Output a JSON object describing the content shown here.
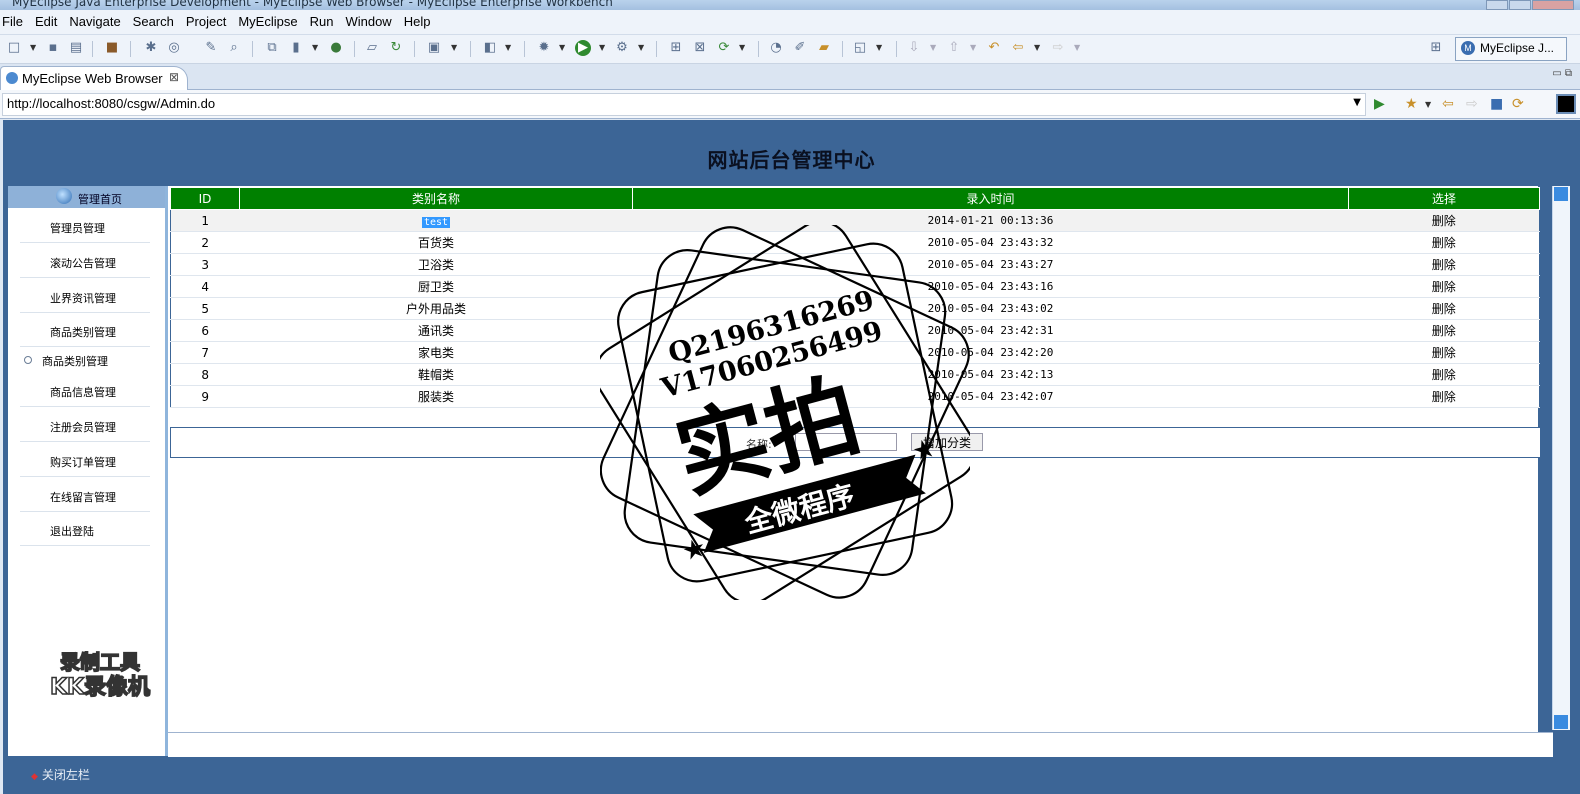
{
  "window": {
    "title": "MyEclipse Java Enterprise Development - MyEclipse Web Browser - MyEclipse Enterprise Workbench"
  },
  "menu": [
    "File",
    "Edit",
    "Navigate",
    "Search",
    "Project",
    "MyEclipse",
    "Run",
    "Window",
    "Help"
  ],
  "perspective": {
    "label": "MyEclipse J..."
  },
  "editor_tab": {
    "label": "MyEclipse Web Browser",
    "close": "⊠"
  },
  "browser": {
    "url": "http://localhost:8080/csgw/Admin.do"
  },
  "page": {
    "title": "网站后台管理中心",
    "sidebar": {
      "home": "管理首页",
      "items": [
        {
          "label": "管理员管理"
        },
        {
          "label": "滚动公告管理"
        },
        {
          "label": "业界资讯管理"
        },
        {
          "label": "商品类别管理"
        },
        {
          "label": "商品类别管理"
        },
        {
          "label": "商品信息管理"
        },
        {
          "label": "注册会员管理"
        },
        {
          "label": "购买订单管理"
        },
        {
          "label": "在线留言管理"
        },
        {
          "label": "退出登陆"
        }
      ]
    },
    "table": {
      "headers": [
        "ID",
        "类别名称",
        "录入时间",
        "选择"
      ],
      "rows": [
        {
          "id": "1",
          "name": "test",
          "time": "2014-01-21 00:13:36",
          "action": "删除"
        },
        {
          "id": "2",
          "name": "百货类",
          "time": "2010-05-04 23:43:32",
          "action": "删除"
        },
        {
          "id": "3",
          "name": "卫浴类",
          "time": "2010-05-04 23:43:27",
          "action": "删除"
        },
        {
          "id": "4",
          "name": "厨卫类",
          "time": "2010-05-04 23:43:16",
          "action": "删除"
        },
        {
          "id": "5",
          "name": "户外用品类",
          "time": "2010-05-04 23:43:02",
          "action": "删除"
        },
        {
          "id": "6",
          "name": "通讯类",
          "time": "2010-05-04 23:42:31",
          "action": "删除"
        },
        {
          "id": "7",
          "name": "家电类",
          "time": "2010-05-04 23:42:20",
          "action": "删除"
        },
        {
          "id": "8",
          "name": "鞋帽类",
          "time": "2010-05-04 23:42:13",
          "action": "删除"
        },
        {
          "id": "9",
          "name": "服装类",
          "time": "2010-05-04 23:42:07",
          "action": "删除"
        }
      ]
    },
    "add_form": {
      "label": "名称:",
      "value": "",
      "button": "增加分类"
    },
    "close_sidebar": "关闭左栏"
  },
  "watermarks": {
    "stamp": {
      "line1": "Q2196316269",
      "line2": "V17060256499",
      "big": "实拍",
      "banner": "全微程序"
    },
    "recorder": {
      "line1": "录制工具",
      "line2": "KK录像机"
    }
  },
  "colors": {
    "header_blue": "#3c6596",
    "table_header_green": "#008000",
    "sidebar_head": "#8eb1d8",
    "selection": "#3399ff"
  }
}
